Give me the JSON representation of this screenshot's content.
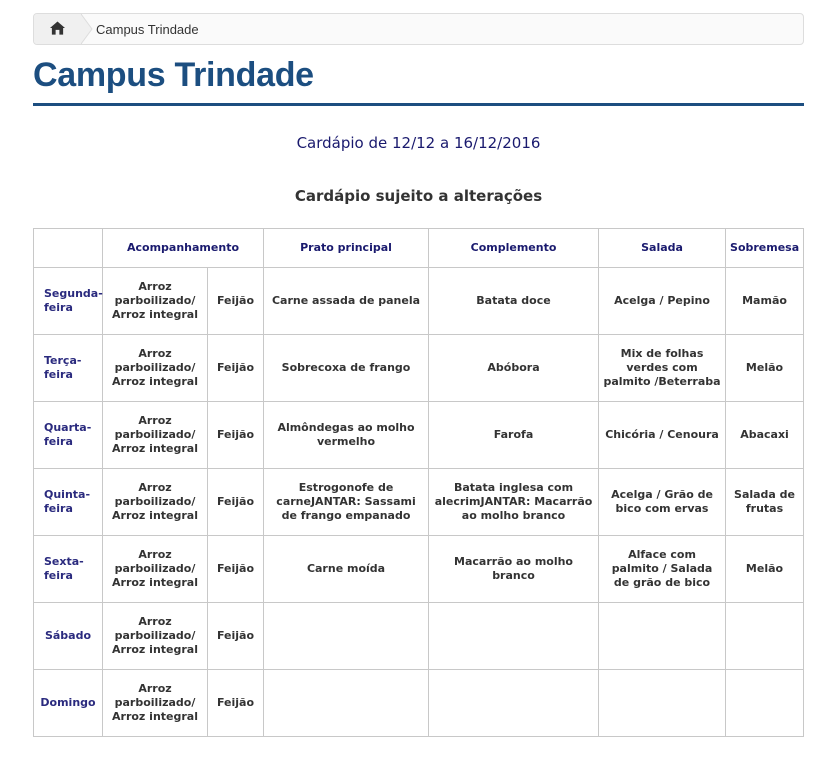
{
  "breadcrumb": {
    "home_icon": "home-icon",
    "current": "Campus Trindade"
  },
  "page": {
    "title": "Campus Trindade",
    "accent_color": "#1c4e80"
  },
  "menu": {
    "dates": "Cardápio de 12/12 a 16/12/2016",
    "note": "Cardápio sujeito a alterações",
    "headers": {
      "day": "",
      "acompanhamento": "Acompanhamento",
      "prato_principal": "Prato principal",
      "complemento": "Complemento",
      "salada": "Salada",
      "sobremesa": "Sobremesa"
    },
    "rows": [
      {
        "day": "Segunda-feira",
        "acomp1": "Arroz parboilizado/ Arroz integral",
        "acomp2": "Feijão",
        "prato": "Carne assada de panela",
        "complemento": "Batata doce",
        "salada": "Acelga / Pepino",
        "sobremesa": "Mamão"
      },
      {
        "day": "Terça-feira",
        "acomp1": "Arroz parboilizado/ Arroz integral",
        "acomp2": "Feijão",
        "prato": "Sobrecoxa de frango",
        "complemento": "Abóbora",
        "salada": "Mix de folhas verdes com palmito /Beterraba",
        "sobremesa": "Melão"
      },
      {
        "day": "Quarta-feira",
        "acomp1": "Arroz parboilizado/ Arroz integral",
        "acomp2": "Feijão",
        "prato": "Almôndegas ao molho vermelho",
        "complemento": "Farofa",
        "salada": "Chicória / Cenoura",
        "sobremesa": "Abacaxi"
      },
      {
        "day": "Quinta-feira",
        "acomp1": "Arroz parboilizado/ Arroz integral",
        "acomp2": "Feijão",
        "prato": "Estrogonofe de carneJANTAR: Sassami de frango empanado",
        "complemento": "Batata inglesa com alecrimJANTAR: Macarrão ao molho branco",
        "salada": "Acelga / Grão de bico com ervas",
        "sobremesa": "Salada de frutas"
      },
      {
        "day": "Sexta-feira",
        "acomp1": "Arroz parboilizado/ Arroz integral",
        "acomp2": "Feijão",
        "prato": "Carne moída",
        "complemento": "Macarrão ao molho branco",
        "salada": "Alface com palmito / Salada de grão de bico",
        "sobremesa": "Melão"
      },
      {
        "day": "Sábado",
        "acomp1": "Arroz parboilizado/ Arroz integral",
        "acomp2": "Feijão",
        "prato": "",
        "complemento": "",
        "salada": "",
        "sobremesa": ""
      },
      {
        "day": "Domingo",
        "acomp1": "Arroz parboilizado/ Arroz integral",
        "acomp2": "Feijão",
        "prato": "",
        "complemento": "",
        "salada": "",
        "sobremesa": ""
      }
    ]
  }
}
